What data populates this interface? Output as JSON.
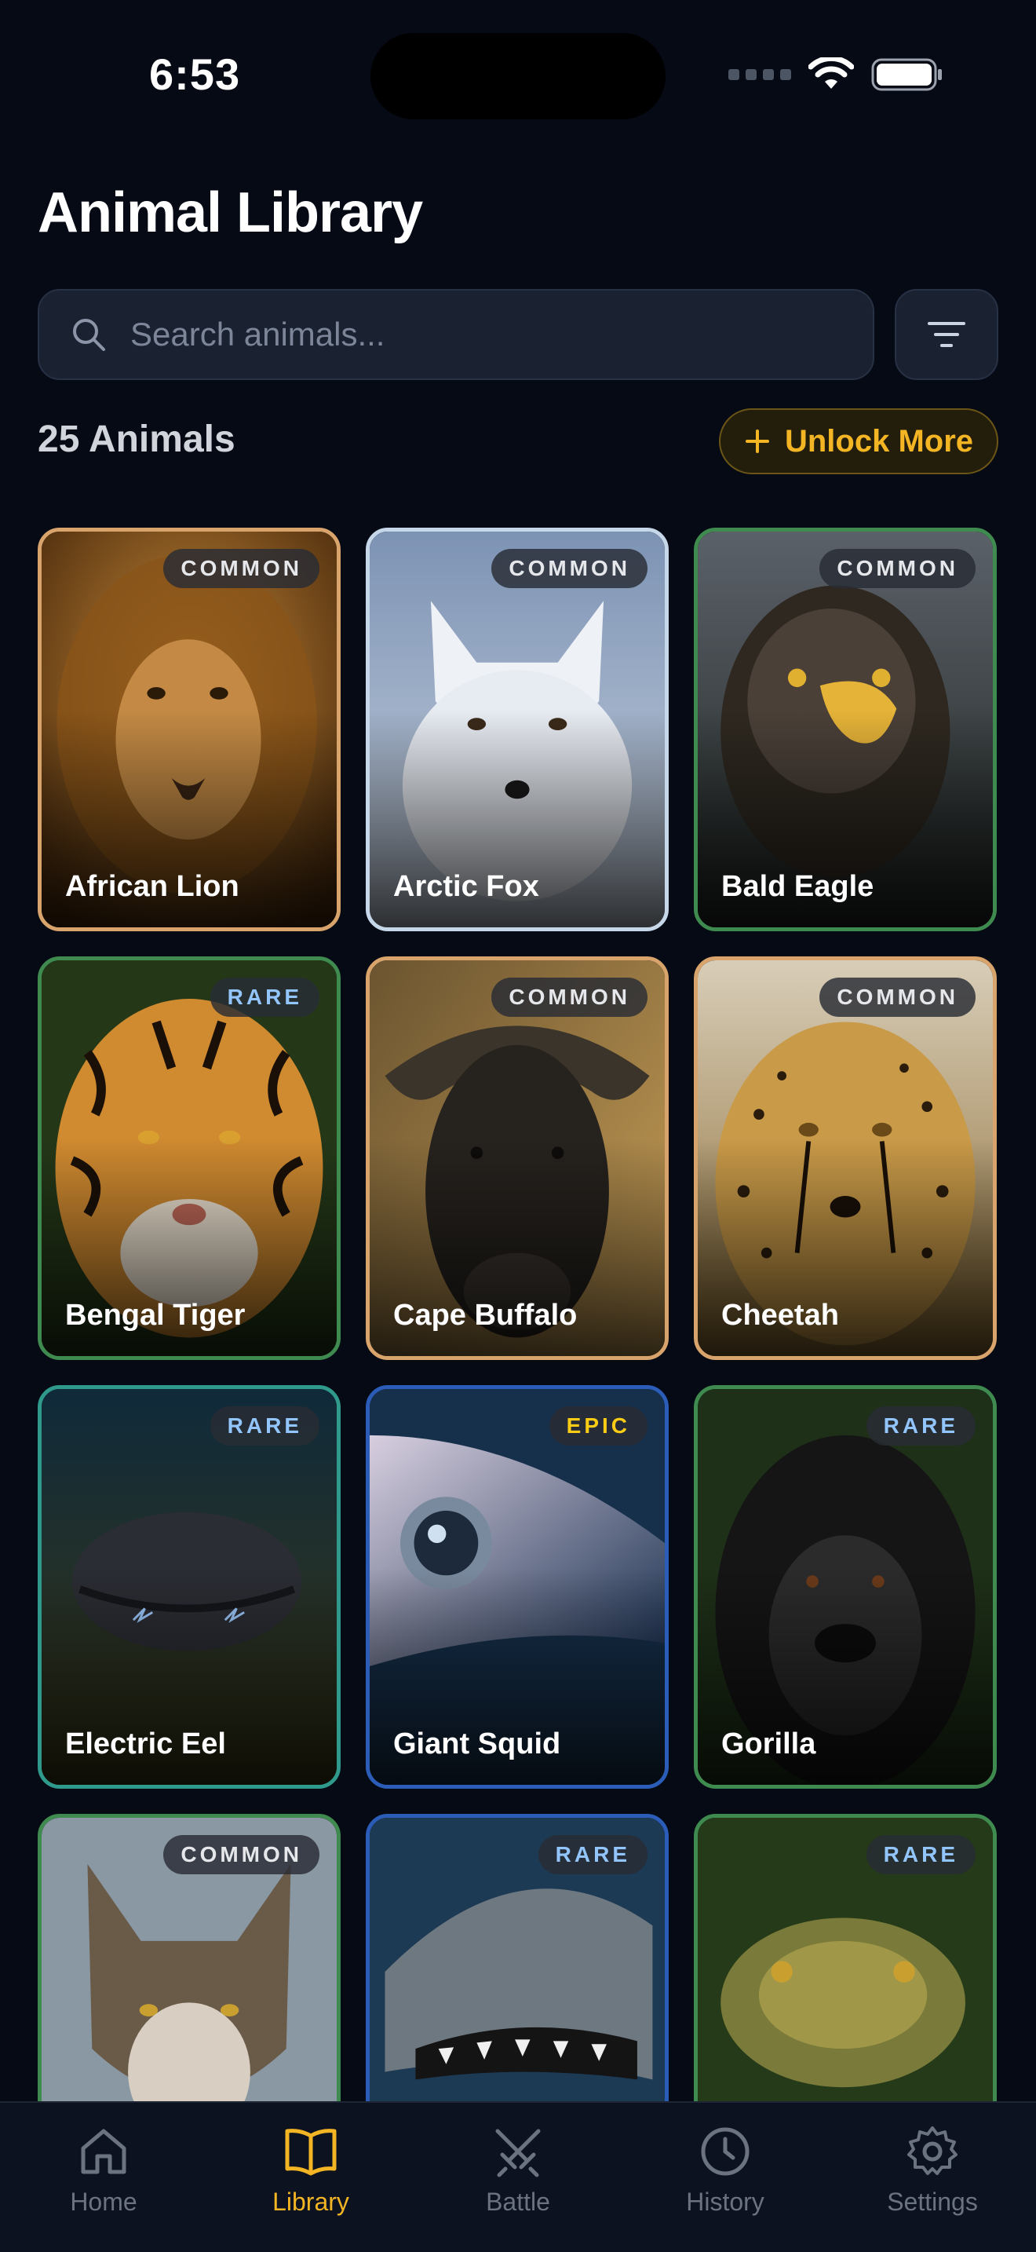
{
  "status": {
    "time": "6:53"
  },
  "header": {
    "title": "Animal Library"
  },
  "search": {
    "placeholder": "Search animals..."
  },
  "summary": {
    "count_label": "25 Animals",
    "unlock_label": "Unlock More"
  },
  "colors": {
    "common": "#d9a46c",
    "rare_green": "#3f8a4f",
    "rare_teal": "#2f9a8c",
    "rare_blue": "#2b5db8",
    "accent": "#f3b523"
  },
  "animals": [
    {
      "name": "African Lion",
      "rarity": "COMMON",
      "icon": "lion-photo"
    },
    {
      "name": "Arctic Fox",
      "rarity": "COMMON",
      "icon": "arctic-fox-photo"
    },
    {
      "name": "Bald Eagle",
      "rarity": "COMMON",
      "icon": "bald-eagle-photo"
    },
    {
      "name": "Bengal Tiger",
      "rarity": "RARE",
      "icon": "tiger-photo"
    },
    {
      "name": "Cape Buffalo",
      "rarity": "COMMON",
      "icon": "buffalo-photo"
    },
    {
      "name": "Cheetah",
      "rarity": "COMMON",
      "icon": "cheetah-photo"
    },
    {
      "name": "Electric Eel",
      "rarity": "RARE",
      "icon": "eel-photo"
    },
    {
      "name": "Giant Squid",
      "rarity": "EPIC",
      "icon": "squid-photo"
    },
    {
      "name": "Gorilla",
      "rarity": "RARE",
      "icon": "gorilla-photo"
    },
    {
      "name": "",
      "rarity": "COMMON",
      "icon": "wolf-photo"
    },
    {
      "name": "",
      "rarity": "RARE",
      "icon": "shark-photo"
    },
    {
      "name": "",
      "rarity": "RARE",
      "icon": "snake-photo"
    }
  ],
  "tabs": [
    {
      "label": "Home",
      "icon": "home-icon"
    },
    {
      "label": "Library",
      "icon": "book-icon",
      "active": true
    },
    {
      "label": "Battle",
      "icon": "swords-icon"
    },
    {
      "label": "History",
      "icon": "clock-icon"
    },
    {
      "label": "Settings",
      "icon": "gear-icon"
    }
  ]
}
